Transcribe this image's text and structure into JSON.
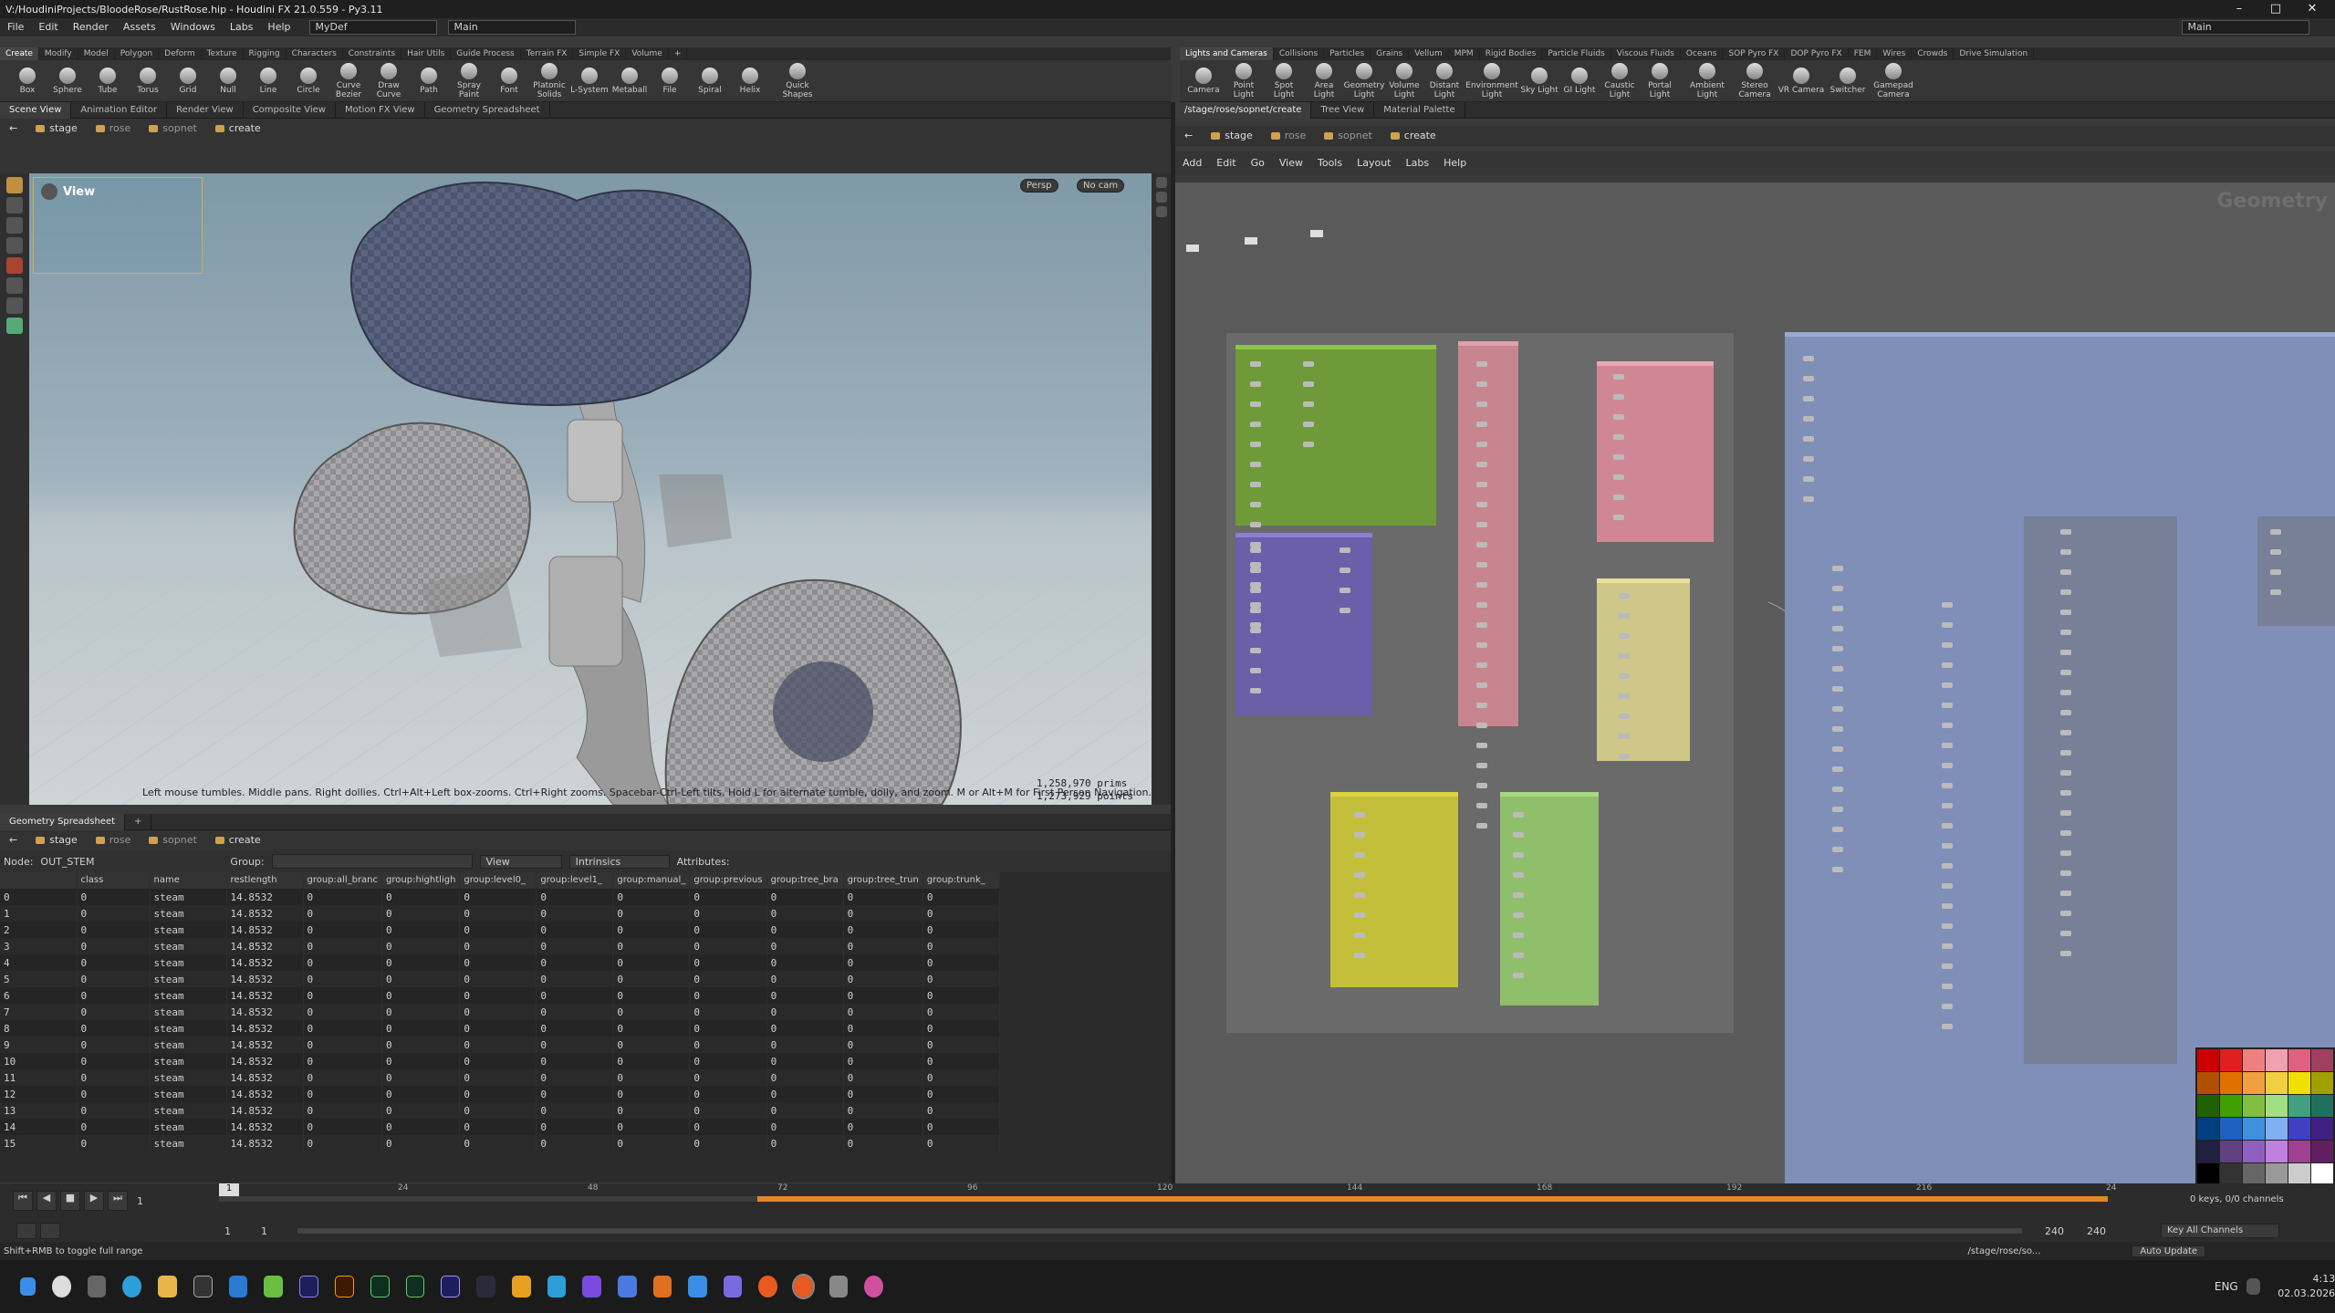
{
  "window": {
    "title": "V:/HoudiniProjects/BloodeRose/RustRose.hip - Houdini FX 21.0.559 - Py3.11"
  },
  "menubar": {
    "items": [
      "File",
      "Edit",
      "Render",
      "Assets",
      "Windows",
      "Labs",
      "Help"
    ],
    "desktop_left": "MyDef",
    "desktop_right": "Main",
    "desktop_far": "Main"
  },
  "shelf_left": {
    "tabs": [
      "Create",
      "Modify",
      "Model",
      "Polygon",
      "Deform",
      "Texture",
      "Rigging",
      "Characters",
      "Constraints",
      "Hair Utils",
      "Guide Process",
      "Terrain FX",
      "Simple FX",
      "Volume"
    ],
    "tools": [
      "Box",
      "Sphere",
      "Tube",
      "Torus",
      "Grid",
      "Null",
      "Line",
      "Circle",
      "Curve Bezier",
      "Draw Curve",
      "Path",
      "Spray Paint",
      "Font",
      "Platonic Solids",
      "L-System",
      "Metaball",
      "File",
      "Spiral",
      "Helix",
      "Quick Shapes"
    ]
  },
  "shelf_right": {
    "tabs": [
      "Lights and Cameras",
      "Collisions",
      "Particles",
      "Grains",
      "Vellum",
      "MPM",
      "Rigid Bodies",
      "Particle Fluids",
      "Viscous Fluids",
      "Oceans",
      "SOP Pyro FX",
      "DOP Pyro FX",
      "FEM",
      "Wires",
      "Crowds",
      "Drive Simulation"
    ],
    "tools": [
      "Camera",
      "Point Light",
      "Spot Light",
      "Area Light",
      "Geometry Light",
      "Volume Light",
      "Distant Light",
      "Environment Light",
      "Sky Light",
      "GI Light",
      "Caustic Light",
      "Portal Light",
      "Ambient Light",
      "Stereo Camera",
      "VR Camera",
      "Switcher",
      "Gamepad Camera"
    ]
  },
  "left_panel_tabs": [
    "Scene View",
    "Animation Editor",
    "Render View",
    "Composite View",
    "Motion FX View",
    "Geometry Spreadsheet"
  ],
  "right_panel_tabs": [
    "/stage/rose/sopnet/create",
    "Tree View",
    "Material Palette"
  ],
  "path": {
    "items": [
      "stage",
      "rose",
      "sopnet",
      "create"
    ]
  },
  "viewport": {
    "label": "View",
    "persp": "Persp",
    "cam": "No cam",
    "hint": "Left mouse tumbles. Middle pans. Right dollies. Ctrl+Alt+Left box-zooms. Ctrl+Right zooms. Spacebar-Ctrl-Left tilts. Hold L for alternate tumble, dolly, and zoom. M or Alt+M for First Person Navigation.",
    "prims": "1,258,970  prims",
    "points": "1,273,929  points"
  },
  "network": {
    "menu": [
      "Add",
      "Edit",
      "Go",
      "View",
      "Tools",
      "Layout",
      "Labs",
      "Help"
    ],
    "context_label": "Geometry"
  },
  "spreadsheet": {
    "tab": "Geometry Spreadsheet",
    "node_label": "Node:",
    "node_value": "OUT_STEM",
    "group_label": "Group:",
    "view_label": "View",
    "intrinsics_label": "Intrinsics",
    "attributes_label": "Attributes:",
    "columns": [
      "",
      "class",
      "name",
      "restlength",
      "group:all_branc",
      "group:hightligh",
      "group:level0_",
      "group:level1_",
      "group:manual_",
      "group:previous",
      "group:tree_bra",
      "group:tree_trun",
      "group:trunk_"
    ],
    "rows": [
      [
        "0",
        "0",
        "steam",
        "14.8532",
        "0",
        "0",
        "0",
        "0",
        "0",
        "0",
        "0",
        "0",
        "0"
      ],
      [
        "1",
        "0",
        "steam",
        "14.8532",
        "0",
        "0",
        "0",
        "0",
        "0",
        "0",
        "0",
        "0",
        "0"
      ],
      [
        "2",
        "0",
        "steam",
        "14.8532",
        "0",
        "0",
        "0",
        "0",
        "0",
        "0",
        "0",
        "0",
        "0"
      ],
      [
        "3",
        "0",
        "steam",
        "14.8532",
        "0",
        "0",
        "0",
        "0",
        "0",
        "0",
        "0",
        "0",
        "0"
      ],
      [
        "4",
        "0",
        "steam",
        "14.8532",
        "0",
        "0",
        "0",
        "0",
        "0",
        "0",
        "0",
        "0",
        "0"
      ],
      [
        "5",
        "0",
        "steam",
        "14.8532",
        "0",
        "0",
        "0",
        "0",
        "0",
        "0",
        "0",
        "0",
        "0"
      ],
      [
        "6",
        "0",
        "steam",
        "14.8532",
        "0",
        "0",
        "0",
        "0",
        "0",
        "0",
        "0",
        "0",
        "0"
      ],
      [
        "7",
        "0",
        "steam",
        "14.8532",
        "0",
        "0",
        "0",
        "0",
        "0",
        "0",
        "0",
        "0",
        "0"
      ],
      [
        "8",
        "0",
        "steam",
        "14.8532",
        "0",
        "0",
        "0",
        "0",
        "0",
        "0",
        "0",
        "0",
        "0"
      ],
      [
        "9",
        "0",
        "steam",
        "14.8532",
        "0",
        "0",
        "0",
        "0",
        "0",
        "0",
        "0",
        "0",
        "0"
      ],
      [
        "10",
        "0",
        "steam",
        "14.8532",
        "0",
        "0",
        "0",
        "0",
        "0",
        "0",
        "0",
        "0",
        "0"
      ],
      [
        "11",
        "0",
        "steam",
        "14.8532",
        "0",
        "0",
        "0",
        "0",
        "0",
        "0",
        "0",
        "0",
        "0"
      ],
      [
        "12",
        "0",
        "steam",
        "14.8532",
        "0",
        "0",
        "0",
        "0",
        "0",
        "0",
        "0",
        "0",
        "0"
      ],
      [
        "13",
        "0",
        "steam",
        "14.8532",
        "0",
        "0",
        "0",
        "0",
        "0",
        "0",
        "0",
        "0",
        "0"
      ],
      [
        "14",
        "0",
        "steam",
        "14.8532",
        "0",
        "0",
        "0",
        "0",
        "0",
        "0",
        "0",
        "0",
        "0"
      ],
      [
        "15",
        "0",
        "steam",
        "14.8532",
        "0",
        "0",
        "0",
        "0",
        "0",
        "0",
        "0",
        "0",
        "0"
      ]
    ]
  },
  "timeline": {
    "ticks": [
      "24",
      "48",
      "72",
      "96",
      "120",
      "144",
      "168",
      "192",
      "216",
      "24"
    ],
    "current_frame": "1",
    "start": "1",
    "start2": "1",
    "end": "240",
    "end2": "240",
    "keys": "0 keys, 0/0 channels",
    "key_mode": "Key All Channels",
    "auto_update": "Auto Update"
  },
  "status": {
    "text": "Shift+RMB to toggle full range",
    "path": "/stage/rose/so..."
  },
  "taskbar": {
    "lang": "ENG",
    "time": "4:13",
    "date": "02.03.2026"
  },
  "colors": {
    "box_green": "#6e9a3a",
    "box_pink": "#c6858f",
    "box_pink2": "#d08795",
    "box_purple": "#6a5fa8",
    "box_yellow": "#c4bf3a",
    "box_lightgreen": "#8fbf6a",
    "box_paleyellow": "#cfc78a",
    "box_blue": "#7f8fb8",
    "accent_orange": "#e2872a"
  }
}
